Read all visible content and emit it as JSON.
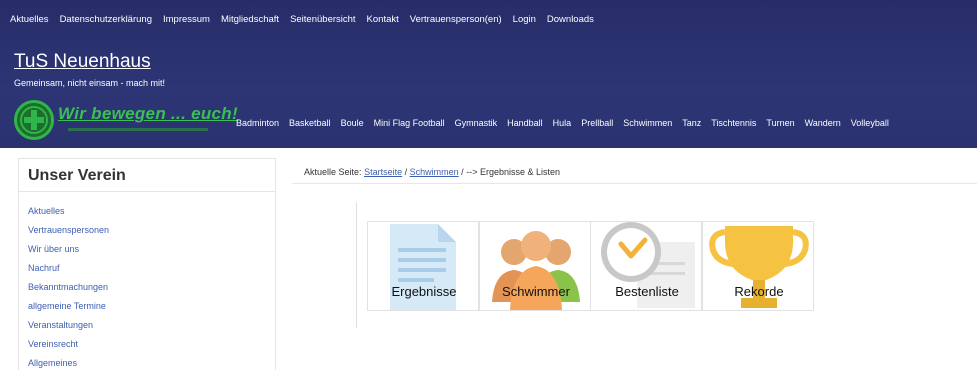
{
  "topnav": [
    "Aktuelles",
    "Datenschutzerklärung",
    "Impressum",
    "Mitgliedschaft",
    "Seitenübersicht",
    "Kontakt",
    "Vertrauensperson(en)",
    "Login",
    "Downloads"
  ],
  "site": {
    "title": "TuS Neuenhaus",
    "tagline": "Gemeinsam, nicht einsam - mach mit!",
    "logo_slogan": "Wir bewegen ... euch!"
  },
  "sportnav": [
    "Badminton",
    "Basketball",
    "Boule",
    "Mini Flag Football",
    "Gymnastik",
    "Handball",
    "Hula",
    "Prellball",
    "Schwimmen",
    "Tanz",
    "Tischtennis",
    "Turnen",
    "Wandern",
    "Volleyball"
  ],
  "sidebar": {
    "title": "Unser Verein",
    "items": [
      "Aktuelles",
      "Vertrauenspersonen",
      "Wir über uns",
      "Nachruf",
      "Bekanntmachungen",
      "allgemeine Termine",
      "Veranstaltungen",
      "Vereinsrecht",
      "Allgemeines"
    ]
  },
  "breadcrumb": {
    "prefix": "Aktuelle Seite:",
    "link1": "Startseite",
    "sep1": "/",
    "link2": "Schwimmen",
    "sep2": "/",
    "current": "--> Ergebnisse & Listen"
  },
  "tiles": [
    {
      "label": "Ergebnisse",
      "icon": "document-icon"
    },
    {
      "label": "Schwimmer",
      "icon": "people-icon"
    },
    {
      "label": "Bestenliste",
      "icon": "clock-icon"
    },
    {
      "label": "Rekorde",
      "icon": "trophy-icon"
    }
  ],
  "colors": {
    "header_bg": "#2d3575",
    "link": "#3d5fb0",
    "logo_green": "#38c152"
  }
}
